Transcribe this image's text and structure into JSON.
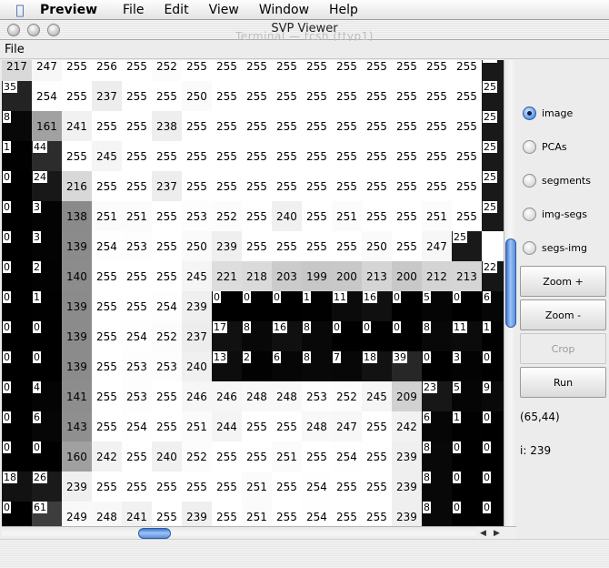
{
  "menubar": {
    "app": "Preview",
    "items": [
      "File",
      "Edit",
      "View",
      "Window",
      "Help"
    ]
  },
  "window": {
    "title": "SVP Viewer",
    "background_title": "Terminal — tcsh (ttyp1)"
  },
  "app_menu": {
    "file": "File"
  },
  "grid": {
    "rows": [
      [
        "217",
        "247",
        "255",
        "256",
        "255",
        "252",
        "255",
        "255",
        "255",
        "255",
        "255",
        "255",
        "255",
        "255",
        "255",
        "255",
        "25"
      ],
      [
        "35",
        "254",
        "255",
        "237",
        "255",
        "255",
        "250",
        "255",
        "255",
        "255",
        "255",
        "255",
        "255",
        "255",
        "255",
        "255",
        "25"
      ],
      [
        "8",
        "161",
        "241",
        "255",
        "255",
        "238",
        "255",
        "255",
        "255",
        "255",
        "255",
        "255",
        "255",
        "255",
        "255",
        "255",
        "25"
      ],
      [
        "1",
        "44",
        "255",
        "245",
        "255",
        "255",
        "255",
        "255",
        "255",
        "255",
        "255",
        "255",
        "255",
        "255",
        "255",
        "255",
        "25"
      ],
      [
        "0",
        "24",
        "216",
        "255",
        "255",
        "237",
        "255",
        "255",
        "255",
        "255",
        "255",
        "255",
        "255",
        "255",
        "255",
        "255",
        "25"
      ],
      [
        "0",
        "3",
        "138",
        "251",
        "251",
        "255",
        "253",
        "252",
        "255",
        "240",
        "255",
        "251",
        "255",
        "255",
        "251",
        "255",
        "25"
      ],
      [
        "0",
        "3",
        "139",
        "254",
        "253",
        "255",
        "250",
        "239",
        "255",
        "255",
        "255",
        "255",
        "250",
        "255",
        "247",
        "25"
      ],
      [
        "0",
        "2",
        "140",
        "255",
        "255",
        "255",
        "245",
        "221",
        "218",
        "203",
        "199",
        "200",
        "213",
        "200",
        "212",
        "213",
        "22"
      ],
      [
        "0",
        "1",
        "139",
        "255",
        "255",
        "254",
        "239",
        "0",
        "0",
        "0",
        "1",
        "11",
        "16",
        "0",
        "5",
        "0",
        "6"
      ],
      [
        "0",
        "0",
        "139",
        "255",
        "254",
        "252",
        "237",
        "17",
        "8",
        "16",
        "8",
        "0",
        "0",
        "0",
        "8",
        "11",
        "1"
      ],
      [
        "0",
        "0",
        "139",
        "255",
        "253",
        "253",
        "240",
        "13",
        "2",
        "6",
        "8",
        "7",
        "18",
        "39",
        "0",
        "3",
        "0"
      ],
      [
        "0",
        "4",
        "141",
        "255",
        "253",
        "255",
        "246",
        "246",
        "248",
        "248",
        "253",
        "252",
        "245",
        "209",
        "23",
        "5",
        "9"
      ],
      [
        "0",
        "6",
        "143",
        "255",
        "254",
        "255",
        "251",
        "244",
        "255",
        "255",
        "248",
        "247",
        "255",
        "242",
        "6",
        "1",
        "0"
      ],
      [
        "0",
        "0",
        "160",
        "242",
        "255",
        "240",
        "252",
        "255",
        "255",
        "251",
        "255",
        "254",
        "255",
        "239",
        "8",
        "0",
        "0"
      ],
      [
        "18",
        "26",
        "239",
        "255",
        "255",
        "255",
        "255",
        "255",
        "251",
        "255",
        "254",
        "255",
        "255",
        "239",
        "8",
        "0",
        "0"
      ],
      [
        "0",
        "61",
        "249",
        "248",
        "241",
        "255",
        "239",
        "255",
        "251",
        "255",
        "254",
        "255",
        "255",
        "239",
        "8",
        "0",
        "0"
      ]
    ]
  },
  "panel": {
    "radios": [
      {
        "label": "image",
        "selected": true
      },
      {
        "label": "PCAs",
        "selected": false
      },
      {
        "label": "segments",
        "selected": false
      },
      {
        "label": "img-segs",
        "selected": false
      },
      {
        "label": "segs-img",
        "selected": false
      }
    ],
    "buttons": {
      "zoom_in": "Zoom +",
      "zoom_out": "Zoom -",
      "crop": "Crop",
      "run": "Run"
    },
    "coords": "(65,44)",
    "intensity": "i: 239"
  },
  "scroll": {
    "vertical_position": 0.4,
    "horizontal_position": 0.3
  }
}
